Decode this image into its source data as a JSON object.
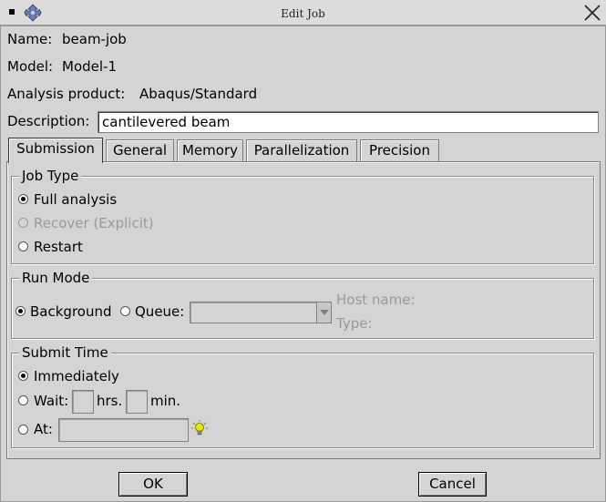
{
  "window": {
    "title": "Edit Job",
    "icons": [
      "window-menu-icon",
      "move-icon",
      "close-icon"
    ]
  },
  "job": {
    "name_label": "Name:",
    "name_value": "beam-job",
    "model_label": "Model:",
    "model_value": "Model-1",
    "product_label": "Analysis product:",
    "product_value": "Abaqus/Standard",
    "description_label": "Description:",
    "description_value": "cantilevered beam"
  },
  "tabs": [
    {
      "label": "Submission",
      "active": true
    },
    {
      "label": "General",
      "active": false
    },
    {
      "label": "Memory",
      "active": false
    },
    {
      "label": "Parallelization",
      "active": false
    },
    {
      "label": "Precision",
      "active": false
    }
  ],
  "job_type": {
    "title": "Job Type",
    "options": [
      {
        "label": "Full analysis",
        "selected": true,
        "enabled": true
      },
      {
        "label": "Recover (Explicit)",
        "selected": false,
        "enabled": false
      },
      {
        "label": "Restart",
        "selected": false,
        "enabled": true
      }
    ]
  },
  "run_mode": {
    "title": "Run Mode",
    "background_label": "Background",
    "background_selected": true,
    "queue_label": "Queue:",
    "queue_selected": false,
    "queue_value": "",
    "host_name_label": "Host name:",
    "type_label": "Type:"
  },
  "submit_time": {
    "title": "Submit Time",
    "immediately_label": "Immediately",
    "immediately_selected": true,
    "wait_label": "Wait:",
    "wait_hrs_value": "",
    "hrs_label": "hrs.",
    "wait_min_value": "",
    "min_label": "min.",
    "at_label": "At:",
    "at_value": "",
    "hint_icon": "lightbulb-icon"
  },
  "buttons": {
    "ok": "OK",
    "cancel": "Cancel"
  },
  "colors": {
    "dialog_bg": "#d4d4d4",
    "disabled_text": "#9a9a9a",
    "hint_icon": "#e8e800"
  }
}
